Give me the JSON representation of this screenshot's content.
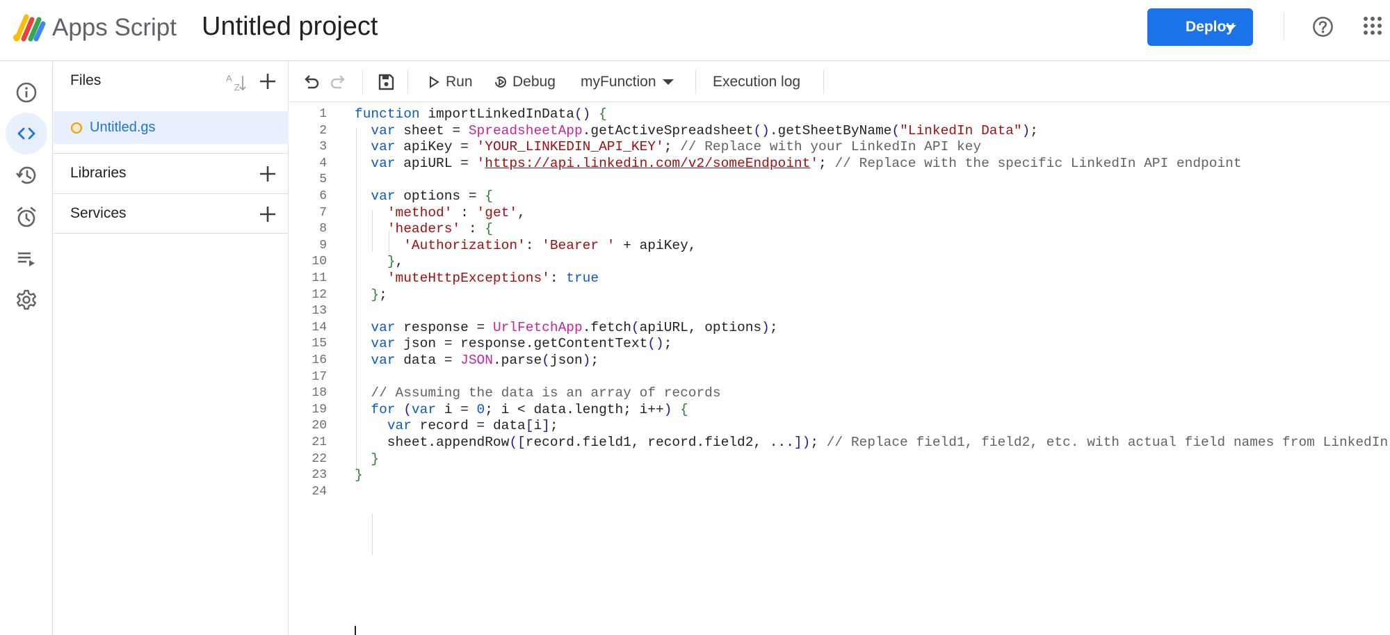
{
  "app": {
    "product_name": "Apps Script",
    "project_title": "Untitled project"
  },
  "header": {
    "deploy_label": "Deploy",
    "brand_color": "#1a73e8"
  },
  "rail": {
    "items": [
      {
        "name": "overview",
        "icon": "info-icon"
      },
      {
        "name": "editor",
        "icon": "code-icon",
        "active": true
      },
      {
        "name": "project-history",
        "icon": "history-icon"
      },
      {
        "name": "triggers",
        "icon": "alarm-clock-icon"
      },
      {
        "name": "executions",
        "icon": "executions-list-icon"
      },
      {
        "name": "project-settings",
        "icon": "gear-icon"
      }
    ]
  },
  "files_panel": {
    "title": "Files",
    "files": [
      {
        "name": "Untitled.gs",
        "selected": true
      }
    ],
    "sections": [
      {
        "title": "Libraries"
      },
      {
        "title": "Services"
      }
    ]
  },
  "toolbar": {
    "run_label": "Run",
    "debug_label": "Debug",
    "function_selector": "myFunction",
    "execution_log_label": "Execution log"
  },
  "editor": {
    "lines": [
      {
        "n": "1",
        "t": "function importLinkedInData() {"
      },
      {
        "n": "2",
        "t": "  var sheet = SpreadsheetApp.getActiveSpreadsheet().getSheetByName(\"LinkedIn Data\");"
      },
      {
        "n": "3",
        "t": "  var apiKey = 'YOUR_LINKEDIN_API_KEY'; // Replace with your LinkedIn API key"
      },
      {
        "n": "4",
        "t": "  var apiURL = 'https://api.linkedin.com/v2/someEndpoint'; // Replace with the specific LinkedIn API endpoint"
      },
      {
        "n": "5",
        "t": ""
      },
      {
        "n": "6",
        "t": "  var options = {"
      },
      {
        "n": "7",
        "t": "    'method' : 'get',"
      },
      {
        "n": "8",
        "t": "    'headers' : {"
      },
      {
        "n": "9",
        "t": "      'Authorization': 'Bearer ' + apiKey,"
      },
      {
        "n": "10",
        "t": "    },"
      },
      {
        "n": "11",
        "t": "    'muteHttpExceptions': true"
      },
      {
        "n": "12",
        "t": "  };"
      },
      {
        "n": "13",
        "t": ""
      },
      {
        "n": "14",
        "t": "  var response = UrlFetchApp.fetch(apiURL, options);"
      },
      {
        "n": "15",
        "t": "  var json = response.getContentText();"
      },
      {
        "n": "16",
        "t": "  var data = JSON.parse(json);"
      },
      {
        "n": "17",
        "t": ""
      },
      {
        "n": "18",
        "t": "  // Assuming the data is an array of records"
      },
      {
        "n": "19",
        "t": "  for (var i = 0; i < data.length; i++) {"
      },
      {
        "n": "20",
        "t": "    var record = data[i];"
      },
      {
        "n": "21",
        "t": "    sheet.appendRow([record.field1, record.field2, ...]); // Replace field1, field2, etc. with actual field names from LinkedIn"
      },
      {
        "n": "22",
        "t": "  }"
      },
      {
        "n": "23",
        "t": "}"
      },
      {
        "n": "24",
        "t": ""
      }
    ]
  }
}
